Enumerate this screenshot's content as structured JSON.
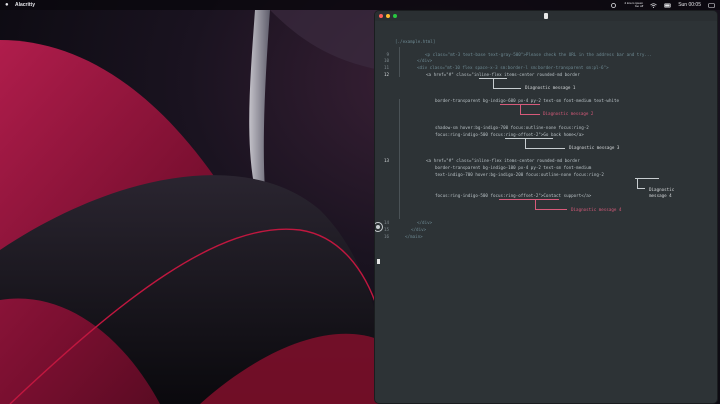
{
  "menubar": {
    "app_name": "Alacritty",
    "clock": "Sun 00:05",
    "tray_small_top": "4 lorem ipsum",
    "tray_small_bottom": "foo off"
  },
  "terminal": {
    "header_path": "[./example.html]",
    "lines": [
      {
        "num": "9",
        "text": "<p class=\"mt-3 text-base text-gray-500\">Please check the URL in the address bar and try..."
      },
      {
        "num": "10",
        "text": "</div>"
      },
      {
        "num": "11",
        "text": "<div class=\"mt-10 flex space-x-3 sm:border-l sm:border-transparent sm:pl-6\">"
      },
      {
        "num": "12",
        "text": "<a href=\"#\" class=\"inline-flex items-center rounded-md border"
      },
      {
        "num": "",
        "text": "border-transparent bg-indigo-600 px-4 py-2 text-sm font-medium text-white"
      },
      {
        "num": "",
        "text": "shadow-sm hover:bg-indigo-700 focus:outline-none focus:ring-2"
      },
      {
        "num": "",
        "text": "focus:ring-indigo-500 focus:ring-offset-2\">Go back home</a>"
      },
      {
        "num": "13",
        "text": "<a href=\"#\" class=\"inline-flex items-center rounded-md border"
      },
      {
        "num": "",
        "text": "border-transparent bg-indigo-100 px-4 py-2 text-sm font-medium"
      },
      {
        "num": "",
        "text": "text-indigo-700 hover:bg-indigo-200 focus:outline-none focus:ring-2"
      },
      {
        "num": "",
        "text": "focus:ring-indigo-500 focus:ring-offset-2\">Contact support</a>"
      },
      {
        "num": "14",
        "text": "</div>"
      },
      {
        "num": "15",
        "text": "</div>"
      },
      {
        "num": "16",
        "text": "</main>"
      }
    ],
    "diagnostics": {
      "d1": "Diagnostic message 1",
      "d2": "Diagnostic message 2",
      "d3": "Diagnostic message 3",
      "d4a": "Diagnostic",
      "d4b": "message 4",
      "d5": "Diagnostic message 4"
    }
  },
  "colors": {
    "terminal_bg": "#2d3336",
    "diag_red": "#d75a7a",
    "text": "#c7cdd0"
  }
}
